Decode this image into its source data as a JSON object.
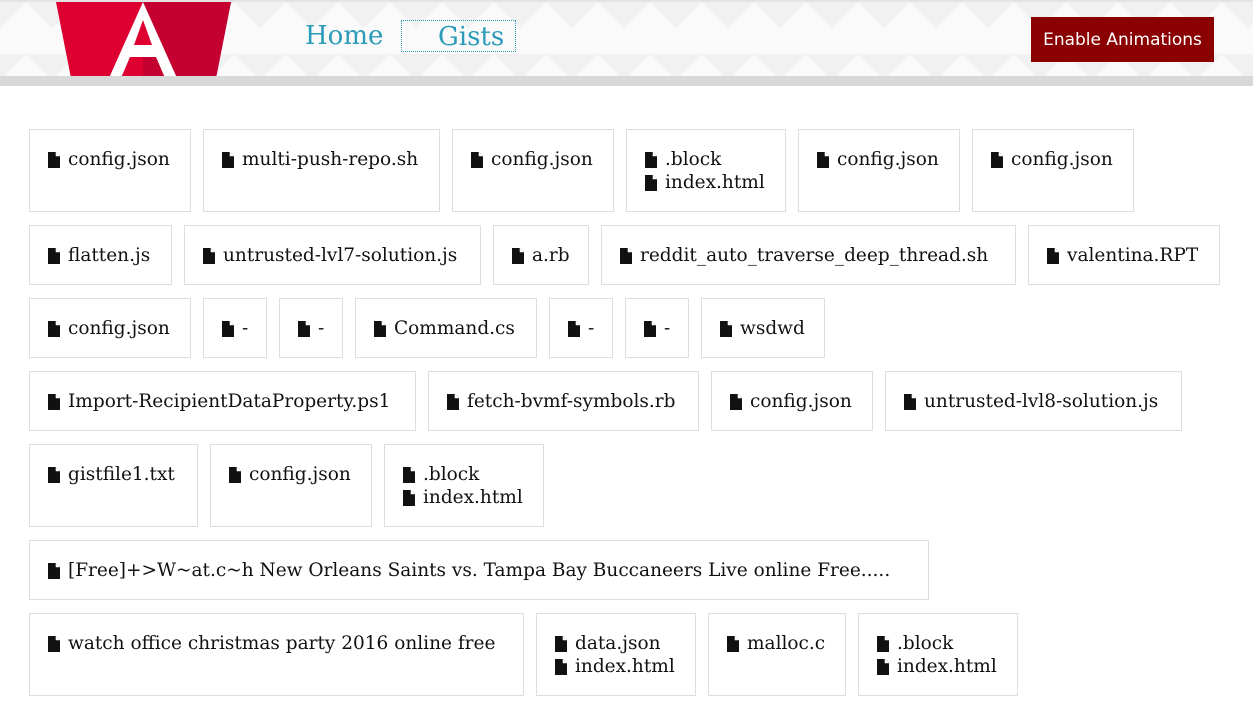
{
  "nav": {
    "home_label": "Home",
    "gists_label": "Gists",
    "animations_button_label": "Enable Animations"
  },
  "colors": {
    "accent": "#2a9bb8",
    "button_bg": "#8b0000",
    "logo_red": "#dd0031"
  },
  "icons": {
    "file": "file-icon",
    "logo": "angular-logo"
  },
  "gist_rows": [
    [
      {
        "files": [
          "config.json"
        ]
      },
      {
        "files": [
          "multi-push-repo.sh"
        ]
      },
      {
        "files": [
          "config.json"
        ]
      },
      {
        "files": [
          ".block",
          "index.html"
        ]
      },
      {
        "files": [
          "config.json"
        ]
      },
      {
        "files": [
          "config.json"
        ]
      }
    ],
    [
      {
        "files": [
          "flatten.js"
        ]
      },
      {
        "files": [
          "untrusted-lvl7-solution.js"
        ]
      },
      {
        "files": [
          "a.rb"
        ]
      },
      {
        "files": [
          "reddit_auto_traverse_deep_thread.sh"
        ]
      },
      {
        "files": [
          "valentina.RPT"
        ]
      }
    ],
    [
      {
        "files": [
          "config.json"
        ]
      },
      {
        "files": [
          "-"
        ]
      },
      {
        "files": [
          "-"
        ]
      },
      {
        "files": [
          "Command.cs"
        ]
      },
      {
        "files": [
          "-"
        ]
      },
      {
        "files": [
          "-"
        ]
      },
      {
        "files": [
          "wsdwd"
        ]
      }
    ],
    [
      {
        "files": [
          "Import-RecipientDataProperty.ps1"
        ]
      },
      {
        "files": [
          "fetch-bvmf-symbols.rb"
        ]
      },
      {
        "files": [
          "config.json"
        ]
      },
      {
        "files": [
          "untrusted-lvl8-solution.js"
        ]
      }
    ],
    [
      {
        "files": [
          "gistfile1.txt"
        ]
      },
      {
        "files": [
          "config.json"
        ]
      },
      {
        "files": [
          ".block",
          "index.html"
        ]
      }
    ],
    [
      {
        "files": [
          "[Free]+>W~at.c~h New Orleans Saints vs. Tampa Bay Buccaneers Live online Free....."
        ]
      }
    ],
    [
      {
        "files": [
          "watch office christmas party 2016 online free"
        ]
      },
      {
        "files": [
          "data.json",
          "index.html"
        ]
      },
      {
        "files": [
          "malloc.c"
        ]
      },
      {
        "files": [
          ".block",
          "index.html"
        ]
      }
    ]
  ]
}
